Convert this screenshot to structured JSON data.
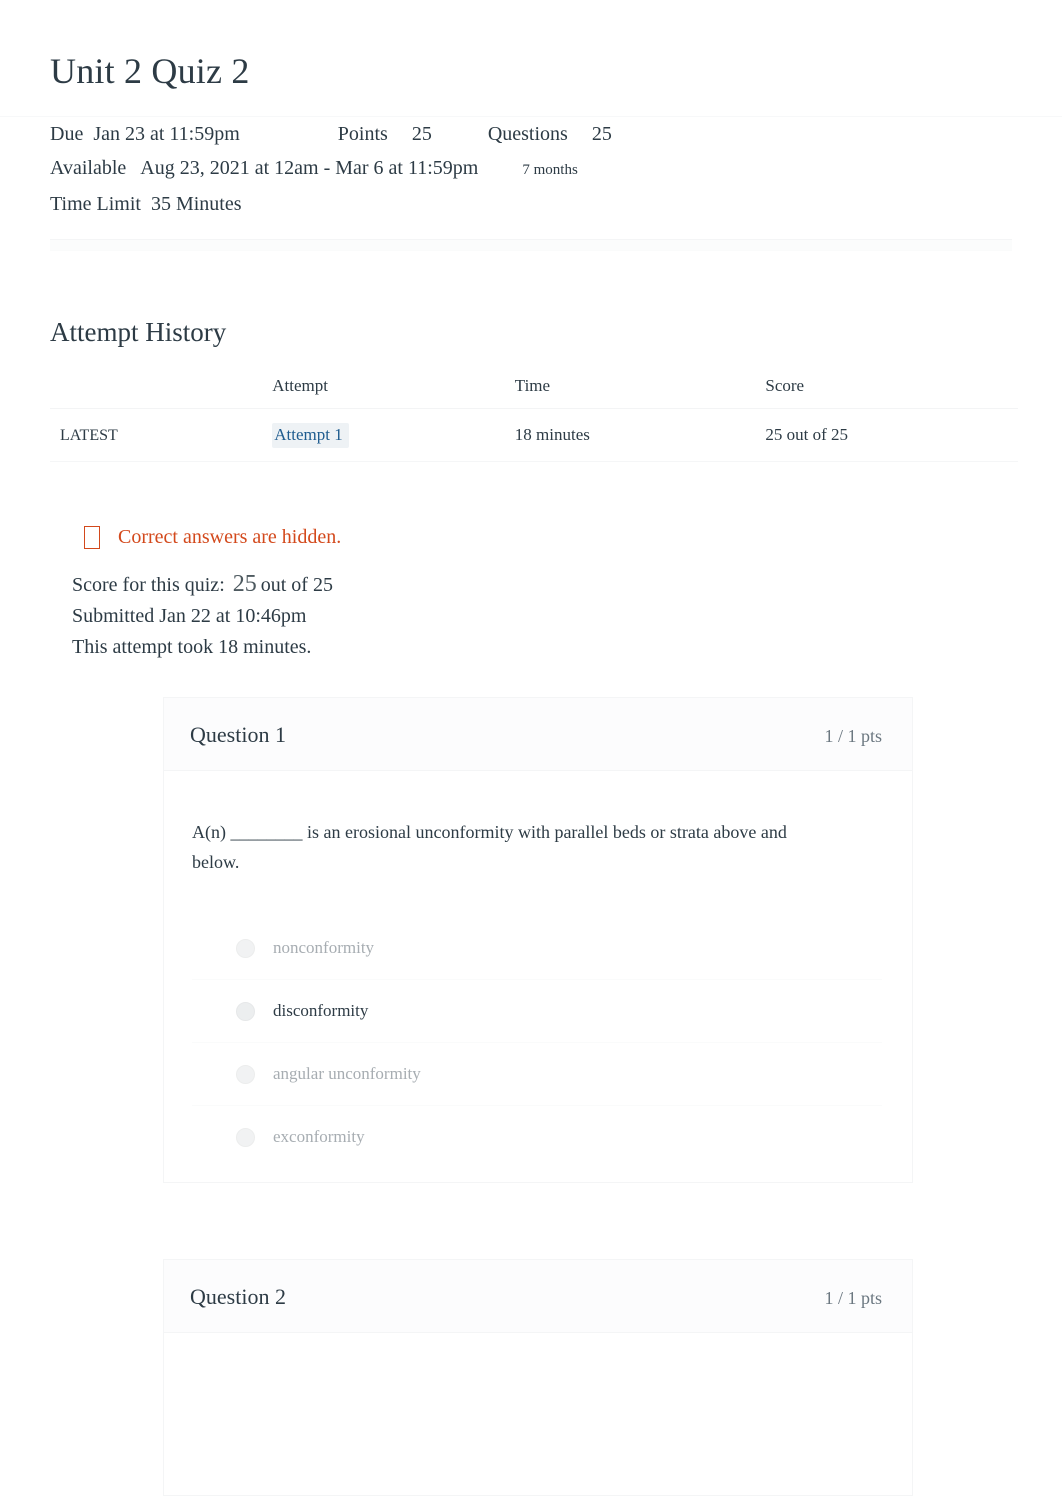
{
  "quiz": {
    "title": "Unit 2 Quiz 2",
    "meta": {
      "due_label": "Due",
      "due_value": "Jan 23 at 11:59pm",
      "points_label": "Points",
      "points_value": "25",
      "questions_label": "Questions",
      "questions_value": "25",
      "available_label": "Available",
      "available_value": "Aug 23, 2021 at 12am - Mar 6 at 11:59pm",
      "available_duration": "7 months",
      "time_limit_label": "Time Limit",
      "time_limit_value": "35 Minutes"
    }
  },
  "attempt_history": {
    "heading": "Attempt History",
    "columns": [
      "",
      "Attempt",
      "Time",
      "Score"
    ],
    "rows": [
      {
        "badge": "LATEST",
        "attempt": "Attempt 1",
        "time": "18 minutes",
        "score": "25 out of 25"
      }
    ]
  },
  "notice": {
    "icon": "eye-slash-icon",
    "text": "Correct answers are hidden.",
    "color": "#d3491c"
  },
  "results": {
    "score_label": "Score for this quiz:",
    "score_value": "25",
    "score_suffix": "out of 25",
    "submitted": "Submitted Jan 22 at 10:46pm",
    "duration": "This attempt took 18 minutes."
  },
  "questions": [
    {
      "name": "Question 1",
      "points": "1 / 1 pts",
      "text": "A(n) ________ is an erosional unconformity with parallel beds or strata above and below.",
      "answers": [
        {
          "label": "nonconformity",
          "selected": false
        },
        {
          "label": "disconformity",
          "selected": true
        },
        {
          "label": "angular unconformity",
          "selected": false
        },
        {
          "label": "exconformity",
          "selected": false
        }
      ]
    },
    {
      "name": "Question 2",
      "points": "1 / 1 pts",
      "text": "",
      "answers": []
    }
  ],
  "colors": {
    "link": "#1f5c8f",
    "text": "#2d3b45",
    "muted": "#a7adb2",
    "warning": "#d3491c"
  }
}
